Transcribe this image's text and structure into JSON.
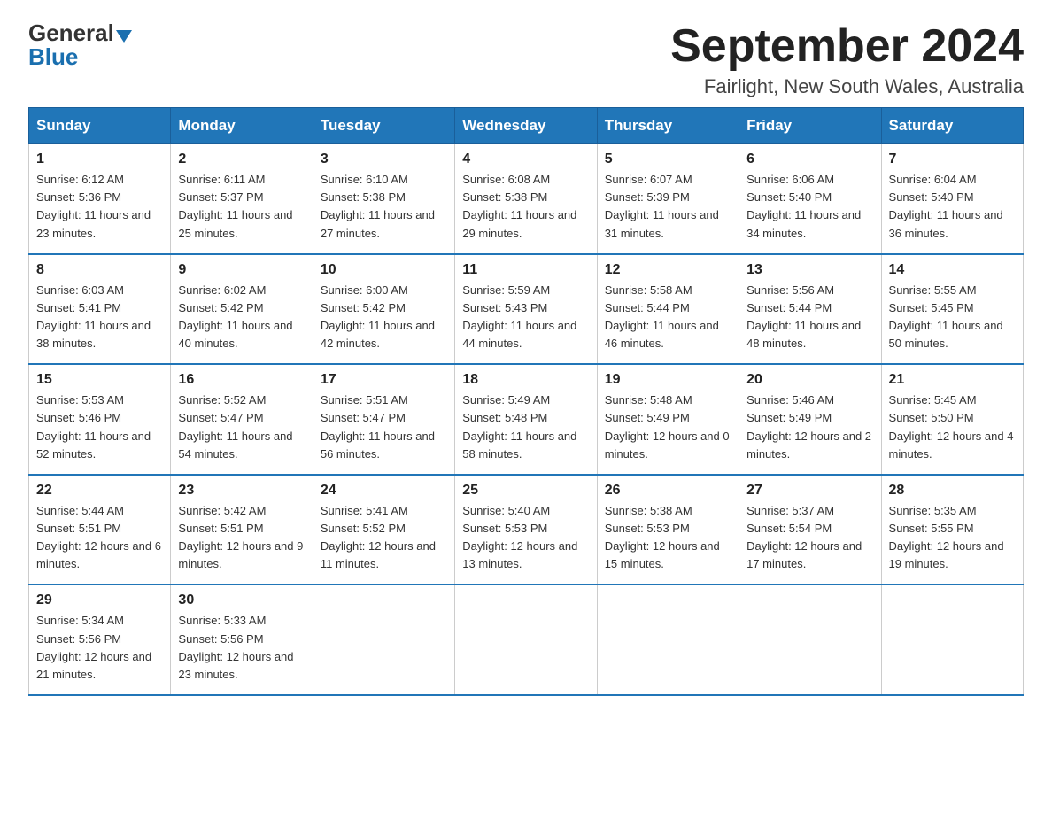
{
  "header": {
    "logo_general": "General",
    "logo_blue": "Blue",
    "month_title": "September 2024",
    "location": "Fairlight, New South Wales, Australia"
  },
  "weekdays": [
    "Sunday",
    "Monday",
    "Tuesday",
    "Wednesday",
    "Thursday",
    "Friday",
    "Saturday"
  ],
  "weeks": [
    [
      {
        "day": "1",
        "sunrise": "6:12 AM",
        "sunset": "5:36 PM",
        "daylight": "11 hours and 23 minutes."
      },
      {
        "day": "2",
        "sunrise": "6:11 AM",
        "sunset": "5:37 PM",
        "daylight": "11 hours and 25 minutes."
      },
      {
        "day": "3",
        "sunrise": "6:10 AM",
        "sunset": "5:38 PM",
        "daylight": "11 hours and 27 minutes."
      },
      {
        "day": "4",
        "sunrise": "6:08 AM",
        "sunset": "5:38 PM",
        "daylight": "11 hours and 29 minutes."
      },
      {
        "day": "5",
        "sunrise": "6:07 AM",
        "sunset": "5:39 PM",
        "daylight": "11 hours and 31 minutes."
      },
      {
        "day": "6",
        "sunrise": "6:06 AM",
        "sunset": "5:40 PM",
        "daylight": "11 hours and 34 minutes."
      },
      {
        "day": "7",
        "sunrise": "6:04 AM",
        "sunset": "5:40 PM",
        "daylight": "11 hours and 36 minutes."
      }
    ],
    [
      {
        "day": "8",
        "sunrise": "6:03 AM",
        "sunset": "5:41 PM",
        "daylight": "11 hours and 38 minutes."
      },
      {
        "day": "9",
        "sunrise": "6:02 AM",
        "sunset": "5:42 PM",
        "daylight": "11 hours and 40 minutes."
      },
      {
        "day": "10",
        "sunrise": "6:00 AM",
        "sunset": "5:42 PM",
        "daylight": "11 hours and 42 minutes."
      },
      {
        "day": "11",
        "sunrise": "5:59 AM",
        "sunset": "5:43 PM",
        "daylight": "11 hours and 44 minutes."
      },
      {
        "day": "12",
        "sunrise": "5:58 AM",
        "sunset": "5:44 PM",
        "daylight": "11 hours and 46 minutes."
      },
      {
        "day": "13",
        "sunrise": "5:56 AM",
        "sunset": "5:44 PM",
        "daylight": "11 hours and 48 minutes."
      },
      {
        "day": "14",
        "sunrise": "5:55 AM",
        "sunset": "5:45 PM",
        "daylight": "11 hours and 50 minutes."
      }
    ],
    [
      {
        "day": "15",
        "sunrise": "5:53 AM",
        "sunset": "5:46 PM",
        "daylight": "11 hours and 52 minutes."
      },
      {
        "day": "16",
        "sunrise": "5:52 AM",
        "sunset": "5:47 PM",
        "daylight": "11 hours and 54 minutes."
      },
      {
        "day": "17",
        "sunrise": "5:51 AM",
        "sunset": "5:47 PM",
        "daylight": "11 hours and 56 minutes."
      },
      {
        "day": "18",
        "sunrise": "5:49 AM",
        "sunset": "5:48 PM",
        "daylight": "11 hours and 58 minutes."
      },
      {
        "day": "19",
        "sunrise": "5:48 AM",
        "sunset": "5:49 PM",
        "daylight": "12 hours and 0 minutes."
      },
      {
        "day": "20",
        "sunrise": "5:46 AM",
        "sunset": "5:49 PM",
        "daylight": "12 hours and 2 minutes."
      },
      {
        "day": "21",
        "sunrise": "5:45 AM",
        "sunset": "5:50 PM",
        "daylight": "12 hours and 4 minutes."
      }
    ],
    [
      {
        "day": "22",
        "sunrise": "5:44 AM",
        "sunset": "5:51 PM",
        "daylight": "12 hours and 6 minutes."
      },
      {
        "day": "23",
        "sunrise": "5:42 AM",
        "sunset": "5:51 PM",
        "daylight": "12 hours and 9 minutes."
      },
      {
        "day": "24",
        "sunrise": "5:41 AM",
        "sunset": "5:52 PM",
        "daylight": "12 hours and 11 minutes."
      },
      {
        "day": "25",
        "sunrise": "5:40 AM",
        "sunset": "5:53 PM",
        "daylight": "12 hours and 13 minutes."
      },
      {
        "day": "26",
        "sunrise": "5:38 AM",
        "sunset": "5:53 PM",
        "daylight": "12 hours and 15 minutes."
      },
      {
        "day": "27",
        "sunrise": "5:37 AM",
        "sunset": "5:54 PM",
        "daylight": "12 hours and 17 minutes."
      },
      {
        "day": "28",
        "sunrise": "5:35 AM",
        "sunset": "5:55 PM",
        "daylight": "12 hours and 19 minutes."
      }
    ],
    [
      {
        "day": "29",
        "sunrise": "5:34 AM",
        "sunset": "5:56 PM",
        "daylight": "12 hours and 21 minutes."
      },
      {
        "day": "30",
        "sunrise": "5:33 AM",
        "sunset": "5:56 PM",
        "daylight": "12 hours and 23 minutes."
      },
      null,
      null,
      null,
      null,
      null
    ]
  ],
  "labels": {
    "sunrise_prefix": "Sunrise: ",
    "sunset_prefix": "Sunset: ",
    "daylight_prefix": "Daylight: "
  }
}
